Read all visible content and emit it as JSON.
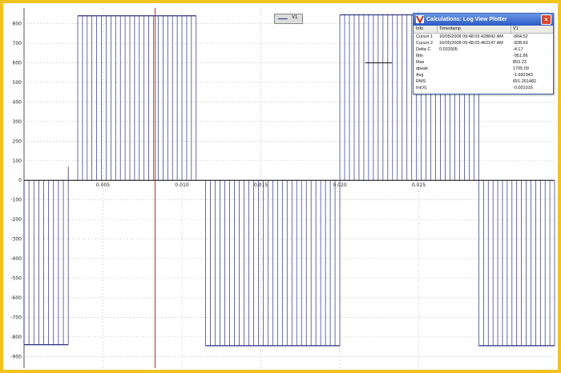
{
  "plot": {
    "y_ticks": [
      "800",
      "700",
      "600",
      "500",
      "400",
      "300",
      "200",
      "100",
      "0",
      "-100",
      "-200",
      "-300",
      "-400",
      "-500",
      "-600",
      "-700",
      "-800",
      "-900"
    ],
    "x_ticks": [
      "0.005",
      "0.010",
      "0.015",
      "0.020",
      "0.025"
    ],
    "colors": {
      "trace": "#2b2f80",
      "cursor": "#b03030",
      "grid": "#c8c8c8",
      "zero": "#000000",
      "frame": "#f2c31f"
    }
  },
  "legend": {
    "label": "V1"
  },
  "calc_window": {
    "title": "Calculations: Log View Plotter",
    "close_icon": "close-icon",
    "app_icon": "app-icon",
    "headers": [
      "Info",
      "Timestamp",
      "V1"
    ],
    "rows": [
      {
        "info": "Cursor 1",
        "timestamp": "16/05/2008 09:48:03.428842 AM",
        "v1": "-804.52"
      },
      {
        "info": "Cursor 2",
        "timestamp": "16/05/2008 09:48:03.462147 AM",
        "v1": "-838.69"
      },
      {
        "info": "Delta C",
        "timestamp": "0.033305",
        "v1": "-4.17"
      },
      {
        "info": "Min",
        "timestamp": "",
        "v1": "-951.86"
      },
      {
        "info": "Max",
        "timestamp": "",
        "v1": "853.23"
      },
      {
        "info": "dpeak",
        "timestamp": "",
        "v1": "1705.09"
      },
      {
        "info": "Avg",
        "timestamp": "",
        "v1": "-1.682343"
      },
      {
        "info": "RMS",
        "timestamp": "",
        "v1": "651.261482"
      },
      {
        "info": "Int(X)",
        "timestamp": "",
        "v1": "-0.001016"
      }
    ]
  },
  "chart_data": {
    "type": "line",
    "xlabel": "",
    "ylabel": "",
    "xlim": [
      0.0,
      0.0336
    ],
    "ylim": [
      -960,
      880
    ],
    "grid": true,
    "legend": "top-center",
    "cursor_x": 0.0083,
    "series": [
      {
        "name": "V1",
        "color": "#2b2f80",
        "segments": [
          {
            "x0": 0.0,
            "x1": 0.0034,
            "level": 0,
            "thin": true
          },
          {
            "x0": 0.0034,
            "x1": 0.0109,
            "level": 840
          },
          {
            "x0": 0.0109,
            "x1": 0.0158,
            "level": 0,
            "thin": true
          },
          {
            "x0": 0.0115,
            "x1": 0.02,
            "level": -845
          },
          {
            "x0": 0.02,
            "x1": 0.0288,
            "level": 845
          },
          {
            "x0": 0.0288,
            "x1": 0.0336,
            "level": -845
          },
          {
            "x0": 0.0,
            "x1": 0.0028,
            "level": -840
          }
        ]
      }
    ]
  }
}
